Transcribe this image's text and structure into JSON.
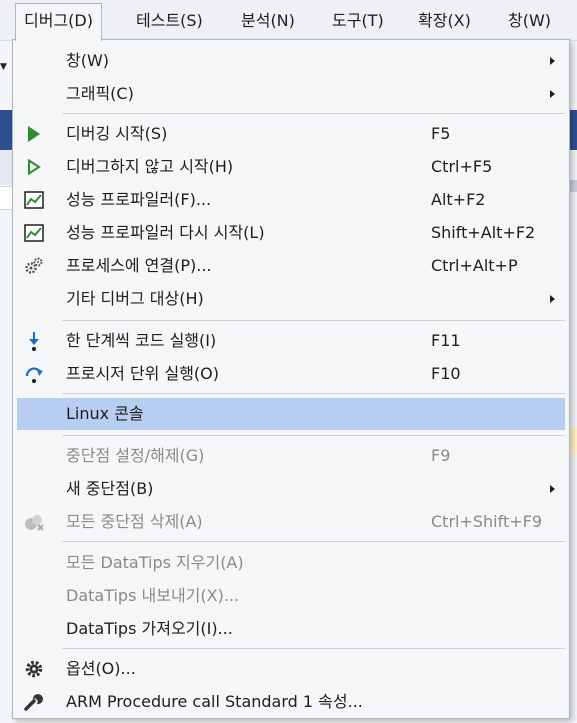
{
  "menubar": {
    "items": [
      "디버그(D)",
      "테스트(S)",
      "분석(N)",
      "도구(T)",
      "확장(X)",
      "창(W)"
    ]
  },
  "menu": {
    "window": {
      "label": "창(W)"
    },
    "graphics": {
      "label": "그래픽(C)"
    },
    "start_debugging": {
      "label": "디버깅 시작(S)",
      "shortcut": "F5"
    },
    "start_without_debugging": {
      "label": "디버그하지 않고 시작(H)",
      "shortcut": "Ctrl+F5"
    },
    "performance_profiler": {
      "label": "성능 프로파일러(F)...",
      "shortcut": "Alt+F2"
    },
    "relaunch_profiler": {
      "label": "성능 프로파일러 다시 시작(L)",
      "shortcut": "Shift+Alt+F2"
    },
    "attach_to_process": {
      "label": "프로세스에 연결(P)...",
      "shortcut": "Ctrl+Alt+P"
    },
    "other_debug_targets": {
      "label": "기타 디버그 대상(H)"
    },
    "step_into": {
      "label": "한 단계씩 코드 실행(I)",
      "shortcut": "F11"
    },
    "step_over": {
      "label": "프로시저 단위 실행(O)",
      "shortcut": "F10"
    },
    "linux_console": {
      "label": "Linux 콘솔"
    },
    "toggle_breakpoint": {
      "label": "중단점 설정/해제(G)",
      "shortcut": "F9"
    },
    "new_breakpoint": {
      "label": "새 중단점(B)"
    },
    "delete_all_breakpoints": {
      "label": "모든 중단점 삭제(A)",
      "shortcut": "Ctrl+Shift+F9"
    },
    "clear_all_datatips": {
      "label": "모든 DataTips 지우기(A)"
    },
    "export_datatips": {
      "label": "DataTips 내보내기(X)..."
    },
    "import_datatips": {
      "label": "DataTips 가져오기(I)..."
    },
    "options": {
      "label": "옵션(O)..."
    },
    "arm_properties": {
      "label": "ARM Procedure call Standard 1 속성..."
    }
  },
  "colors": {
    "highlight": "#b8cdf2",
    "play_green": "#2e8b2e",
    "step_blue": "#1b6fc0",
    "disabled_text": "#8a8a8a"
  }
}
